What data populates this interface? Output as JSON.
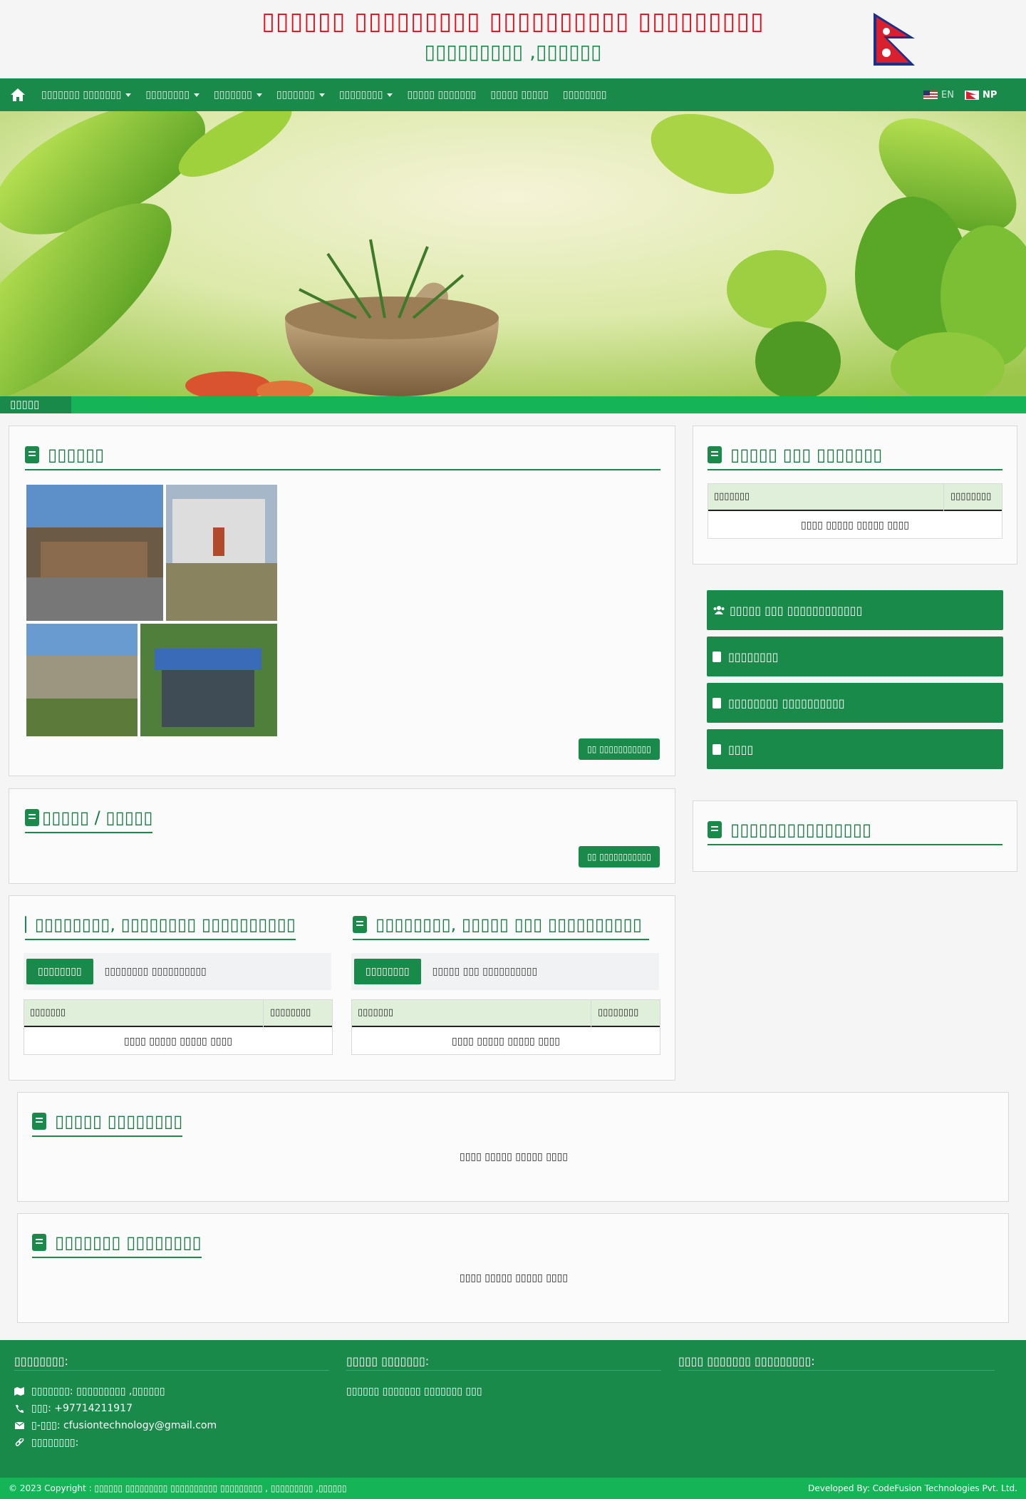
{
  "header": {
    "title": "▯▯▯▯▯▯ ▯▯▯▯▯▯▯▯▯ ▯▯▯▯▯▯▯▯▯▯ ▯▯▯▯▯▯▯▯▯",
    "subtitle": "▯▯▯▯▯▯▯▯▯ ,▯▯▯▯▯▯"
  },
  "nav": {
    "items": [
      {
        "label": "▯▯▯▯▯▯▯ ▯▯▯▯▯▯▯",
        "dropdown": true
      },
      {
        "label": "▯▯▯▯▯▯▯▯",
        "dropdown": true
      },
      {
        "label": "▯▯▯▯▯▯▯",
        "dropdown": true
      },
      {
        "label": "▯▯▯▯▯▯▯",
        "dropdown": true
      },
      {
        "label": "▯▯▯▯▯▯▯▯",
        "dropdown": true
      },
      {
        "label": "▯▯▯▯▯ ▯▯▯▯▯▯▯",
        "dropdown": false
      },
      {
        "label": "▯▯▯▯▯ ▯▯▯▯▯",
        "dropdown": false
      },
      {
        "label": "▯▯▯▯▯▯▯▯",
        "dropdown": false
      }
    ],
    "lang_en": "EN",
    "lang_np": "NP"
  },
  "ticker": {
    "label": "▯▯▯▯▯ ▯▯▯▯▯▯"
  },
  "intro": {
    "title": "▯▯▯▯▯▯",
    "more": "▯▯ ▯▯▯▯▯▯▯▯▯▯▯"
  },
  "news": {
    "title": "▯▯▯▯▯ / ▯▯▯▯▯",
    "more": "▯▯ ▯▯▯▯▯▯▯▯▯▯▯"
  },
  "left_tabs": {
    "title": "▯▯▯▯▯▯▯▯, ▯▯▯▯▯▯▯▯ ▯▯▯▯▯▯▯▯▯▯",
    "active_tab": "▯▯▯▯▯▯▯▯",
    "other_tab": "▯▯▯▯▯▯▯▯ ▯▯▯▯▯▯▯▯▯▯",
    "col1": "▯▯▯▯▯▯▯",
    "col2": "▯▯▯▯▯▯▯▯",
    "empty": "▯▯▯▯ ▯▯▯▯▯ ▯▯▯▯▯ ▯▯▯▯"
  },
  "right_tabs": {
    "title": "▯▯▯▯▯▯▯▯, ▯▯▯▯▯ ▯▯▯ ▯▯▯▯▯▯▯▯▯▯",
    "active_tab": "▯▯▯▯▯▯▯▯",
    "other_tab": "▯▯▯▯▯ ▯▯▯ ▯▯▯▯▯▯▯▯▯▯",
    "col1": "▯▯▯▯▯▯▯",
    "col2": "▯▯▯▯▯▯▯▯",
    "empty": "▯▯▯▯ ▯▯▯▯▯ ▯▯▯▯▯ ▯▯▯▯"
  },
  "sidebar": {
    "notice_title": "▯▯▯▯▯ ▯▯▯ ▯▯▯▯▯▯▯",
    "notice_col1": "▯▯▯▯▯▯▯",
    "notice_col2": "▯▯▯▯▯▯▯▯",
    "notice_empty": "▯▯▯▯ ▯▯▯▯▯ ▯▯▯▯▯ ▯▯▯▯",
    "buttons": [
      "▯▯▯▯▯ ▯▯▯ ▯▯▯▯▯▯▯▯▯▯▯▯",
      "▯▯▯▯▯▯▯▯",
      "▯▯▯▯▯▯▯▯ ▯▯▯▯▯▯▯▯▯▯",
      "▯▯▯▯"
    ],
    "contacts_title": "▯▯▯▯▯▯▯▯▯▯▯▯▯▯▯"
  },
  "section_a": {
    "title": "▯▯▯▯▯ ▯▯▯▯▯▯▯▯",
    "empty": "▯▯▯▯ ▯▯▯▯▯ ▯▯▯▯▯ ▯▯▯▯"
  },
  "section_b": {
    "title": "▯▯▯▯▯▯▯ ▯▯▯▯▯▯▯▯",
    "empty": "▯▯▯▯ ▯▯▯▯▯ ▯▯▯▯▯ ▯▯▯▯"
  },
  "footer": {
    "col1_title": "▯▯▯▯▯▯▯▯:",
    "col2_title": "▯▯▯▯▯ ▯▯▯▯▯▯▯:",
    "col3_title": "▯▯▯▯ ▯▯▯▯▯▯▯ ▯▯▯▯▯▯▯▯▯:",
    "address": "▯▯▯▯▯▯▯: ▯▯▯▯▯▯▯▯▯ ,▯▯▯▯▯▯",
    "phone": "▯▯▯: +97714211917",
    "email": "▯-▯▯▯: cfusiontechnology@gmail.com",
    "website": "▯▯▯▯▯▯▯▯:",
    "link": "▯▯▯▯▯▯ ▯▯▯▯▯▯▯ ▯▯▯▯▯▯▯ ▯▯▯",
    "copyright": "© 2023 Copyright : ▯▯▯▯▯▯ ▯▯▯▯▯▯▯▯▯ ▯▯▯▯▯▯▯▯▯▯ ▯▯▯▯▯▯▯▯▯ , ▯▯▯▯▯▯▯▯▯ ,▯▯▯▯▯▯",
    "developer": "Developed By: CodeFusion Technologies Pvt. Ltd."
  },
  "colors": {
    "primary": "#1a8a4a",
    "ticker": "#14b457",
    "title_red": "#e0101a"
  }
}
